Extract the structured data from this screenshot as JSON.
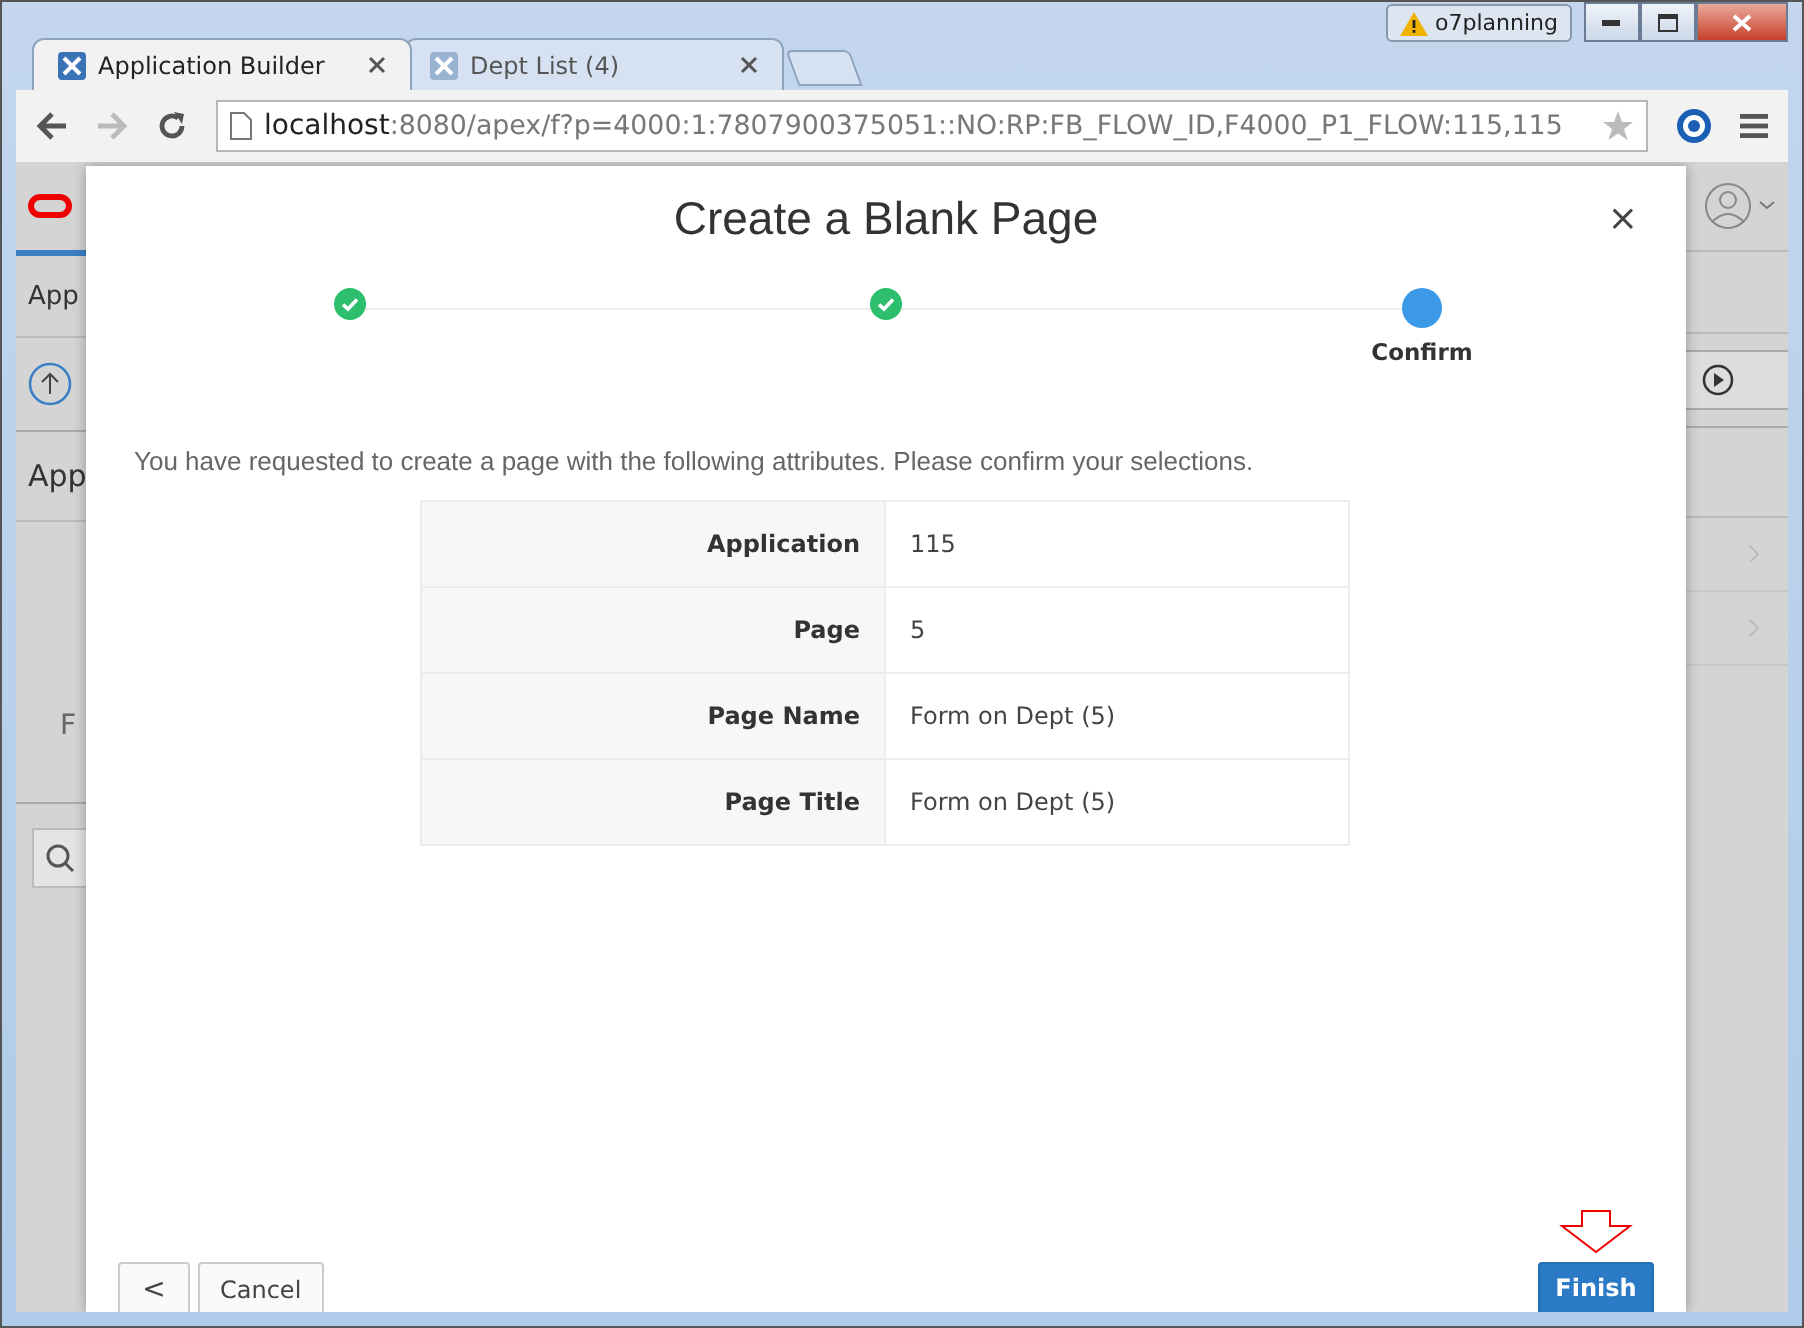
{
  "window": {
    "profile": "o7planning"
  },
  "tabs": [
    {
      "title": "Application Builder",
      "selected": true
    },
    {
      "title": "Dept List (4)",
      "selected": false
    }
  ],
  "address": {
    "host": "localhost",
    "path": ":8080/apex/f?p=4000:1:7807900375051::NO:RP:FB_FLOW_ID,F4000_P1_FLOW:115,115"
  },
  "background": {
    "tab_label": "App",
    "section_label": "App",
    "side_label": "F"
  },
  "dialog": {
    "title": "Create a Blank Page",
    "close": "×",
    "steps": [
      {
        "kind": "done"
      },
      {
        "kind": "done"
      },
      {
        "kind": "current",
        "label": "Confirm"
      }
    ],
    "intro": "You have requested to create a page with the following attributes. Please confirm your selections.",
    "rows": [
      {
        "label": "Application",
        "value": "115"
      },
      {
        "label": "Page",
        "value": "5"
      },
      {
        "label": "Page Name",
        "value": "Form on Dept (5)"
      },
      {
        "label": "Page Title",
        "value": "Form on Dept (5)"
      }
    ],
    "buttons": [
      {
        "kind": "back",
        "label": "<"
      },
      {
        "kind": "plain",
        "label": "Cancel"
      },
      {
        "kind": "primary",
        "label": "Finish"
      }
    ]
  }
}
